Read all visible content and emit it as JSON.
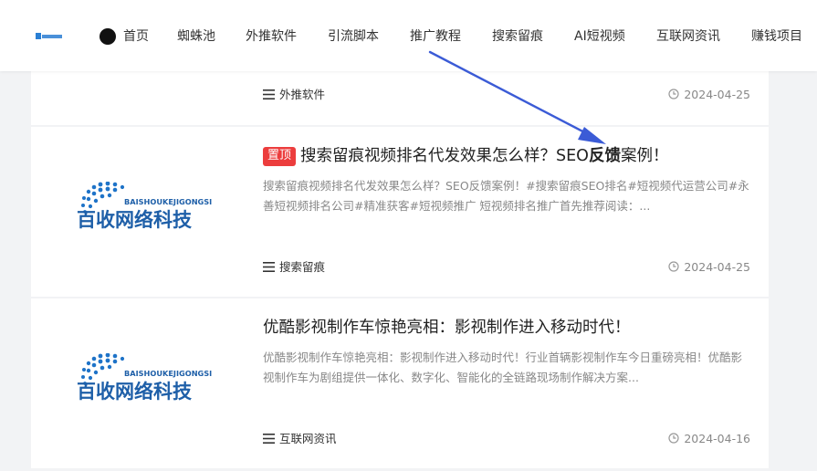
{
  "nav": {
    "items": [
      "首页",
      "蜘蛛池",
      "外推软件",
      "引流脚本",
      "推广教程",
      "搜索留痕",
      "AI短视频",
      "互联网资讯",
      "赚钱项目"
    ]
  },
  "thumb": {
    "brand_en": "BAISHOUKEJIGONGSI",
    "brand_cn": "百收网络科技"
  },
  "posts": [
    {
      "category": "外推软件",
      "date": "2024-04-25"
    },
    {
      "badge": "置顶",
      "title_pre": "搜索留痕视频排名代发效果怎么样？SEO",
      "title_bold": "反馈",
      "title_post": "案例！",
      "excerpt": "搜索留痕视频排名代发效果怎么样？SEO反馈案例！#搜索留痕SEO排名#短视频代运营公司#永善短视频排名公司#精准获客#短视频推广 短视频排名推广首先推荐阅读：...",
      "category": "搜索留痕",
      "date": "2024-04-25"
    },
    {
      "title": "优酷影视制作车惊艳亮相：影视制作进入移动时代！",
      "excerpt": "优酷影视制作车惊艳亮相：影视制作进入移动时代！行业首辆影视制作车今日重磅亮相！优酷影视制作车为剧组提供一体化、数字化、智能化的全链路现场制作解决方案...",
      "category": "互联网资讯",
      "date": "2024-04-16"
    }
  ],
  "colors": {
    "badge": "#ec3d3d",
    "arrow": "#3b5bd6",
    "logo_blue": "#1e5fa8"
  }
}
